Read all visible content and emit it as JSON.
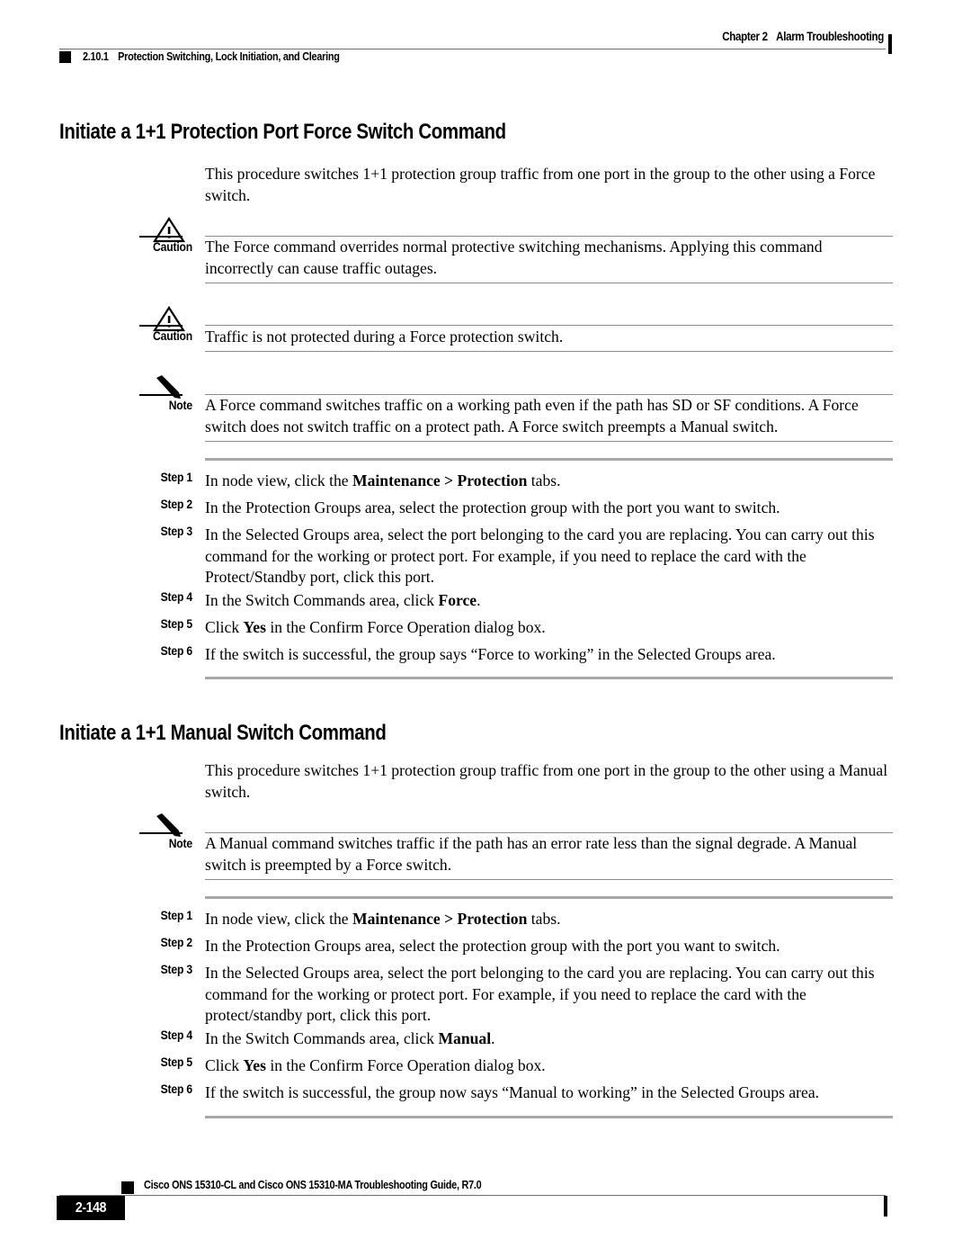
{
  "header": {
    "chapter": "Chapter 2",
    "chapter_title": "Alarm Troubleshooting",
    "section_number": "2.10.1",
    "section_title": "Protection Switching, Lock Initiation, and Clearing"
  },
  "sections": [
    {
      "heading": "Initiate a 1+1 Protection Port Force Switch Command",
      "intro": "This procedure switches 1+1 protection group traffic from one port in the group to the other using a Force switch.",
      "admonitions": [
        {
          "kind": "caution",
          "label": "Caution",
          "icon": "warning-triangle-icon",
          "text": "The Force command overrides normal protective switching mechanisms. Applying this command incorrectly can cause traffic outages."
        },
        {
          "kind": "caution",
          "label": "Caution",
          "icon": "warning-triangle-icon",
          "text": "Traffic is not protected during a Force protection switch."
        },
        {
          "kind": "note",
          "label": "Note",
          "icon": "pencil-icon",
          "text": "A Force command switches traffic on a working path even if the path has SD or SF conditions. A Force switch does not switch traffic on a protect path. A Force switch preempts a Manual switch."
        }
      ],
      "steps": [
        {
          "label": "Step 1",
          "text_pre": "In node view, click the ",
          "bold": "Maintenance > Protection",
          "text_post": " tabs."
        },
        {
          "label": "Step 2",
          "text_pre": "In the Protection Groups area, select the protection group with the port you want to switch.",
          "bold": "",
          "text_post": ""
        },
        {
          "label": "Step 3",
          "text_pre": "In the Selected Groups area, select the port belonging to the card you are replacing. You can carry out this command for the working or protect port. For example, if you need to replace the card with the Protect/Standby port, click this port.",
          "bold": "",
          "text_post": ""
        },
        {
          "label": "Step 4",
          "text_pre": "In the Switch Commands area, click ",
          "bold": "Force",
          "text_post": "."
        },
        {
          "label": "Step 5",
          "text_pre": "Click ",
          "bold": "Yes",
          "text_post": " in the Confirm Force Operation dialog box."
        },
        {
          "label": "Step 6",
          "text_pre": "If the switch is successful, the group says “Force to working” in the Selected Groups area.",
          "bold": "",
          "text_post": ""
        }
      ]
    },
    {
      "heading": "Initiate a 1+1 Manual Switch Command",
      "intro": "This procedure switches 1+1 protection group traffic from one port in the group to the other using a Manual switch.",
      "admonitions": [
        {
          "kind": "note",
          "label": "Note",
          "icon": "pencil-icon",
          "text": "A Manual command switches traffic if the path has an error rate less than the signal degrade. A Manual switch is preempted by a Force switch."
        }
      ],
      "steps": [
        {
          "label": "Step 1",
          "text_pre": "In node view, click the ",
          "bold": "Maintenance > Protection",
          "text_post": " tabs."
        },
        {
          "label": "Step 2",
          "text_pre": "In the Protection Groups area, select the protection group with the port you want to switch.",
          "bold": "",
          "text_post": ""
        },
        {
          "label": "Step 3",
          "text_pre": "In the Selected Groups area, select the port belonging to the card you are replacing. You can carry out this command for the working or protect port. For example, if you need to replace the card with the protect/standby port, click this port.",
          "bold": "",
          "text_post": ""
        },
        {
          "label": "Step 4",
          "text_pre": "In the Switch Commands area, click ",
          "bold": "Manual",
          "text_post": "."
        },
        {
          "label": "Step 5",
          "text_pre": "Click ",
          "bold": "Yes",
          "text_post": " in the Confirm Force Operation dialog box."
        },
        {
          "label": "Step 6",
          "text_pre": "If the switch is successful, the group now says “Manual to working” in the Selected Groups area.",
          "bold": "",
          "text_post": ""
        }
      ]
    }
  ],
  "footer": {
    "guide_title": "Cisco ONS 15310-CL and Cisco ONS 15310-MA Troubleshooting Guide, R7.0",
    "page_number": "2-148"
  },
  "colors": {
    "text": "#000000",
    "rule": "#8c8c8c",
    "steps_rule": "#a7a7a7",
    "page_box": "#000000"
  }
}
